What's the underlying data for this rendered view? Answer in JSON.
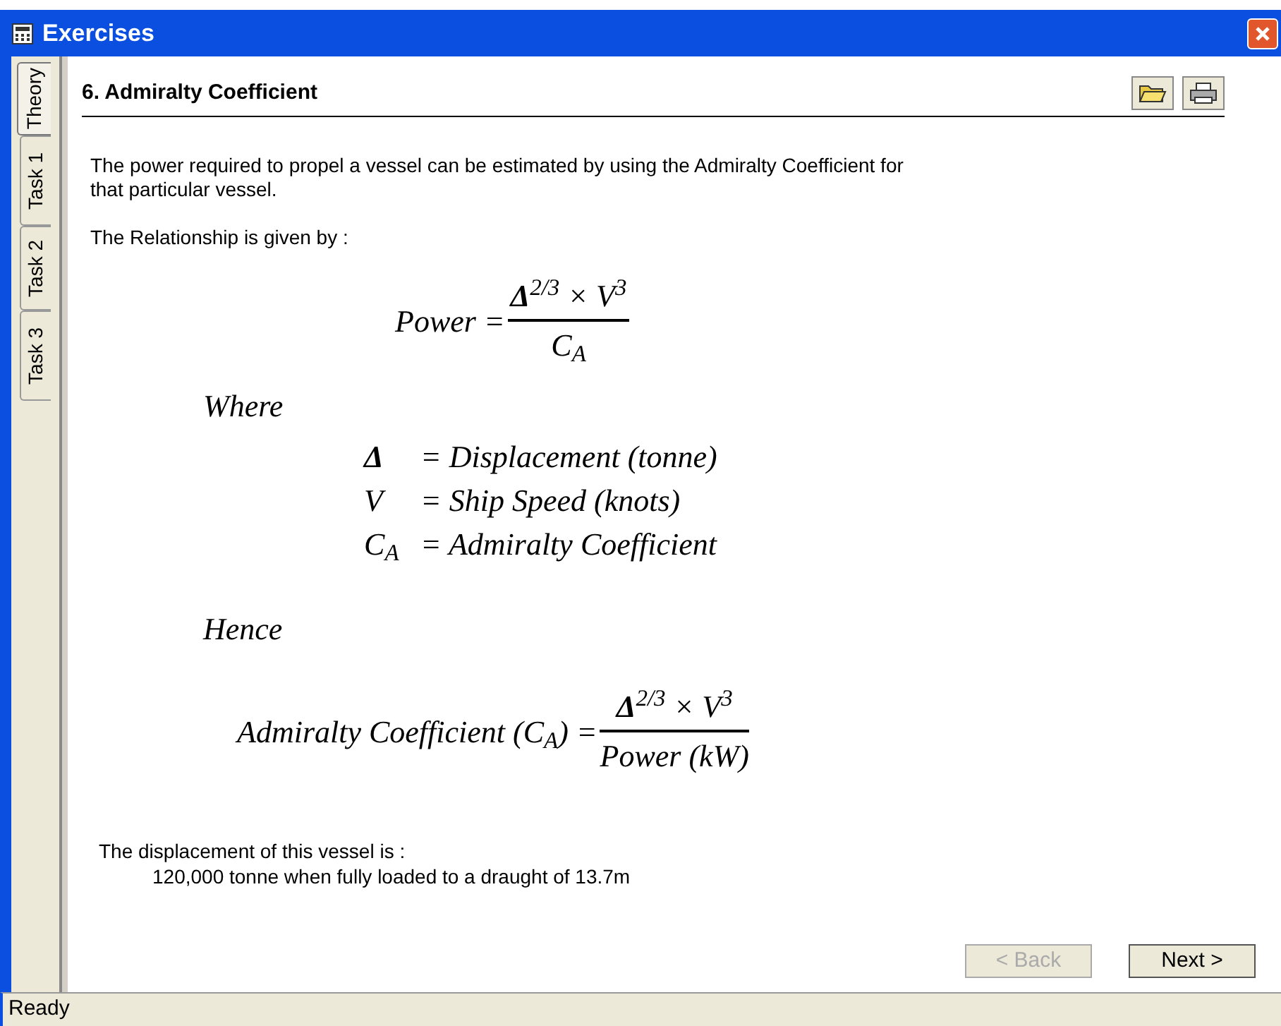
{
  "window": {
    "title": "Exercises"
  },
  "tabs": [
    {
      "label": "Theory",
      "selected": true
    },
    {
      "label": "Task 1",
      "selected": false
    },
    {
      "label": "Task 2",
      "selected": false
    },
    {
      "label": "Task 3",
      "selected": false
    }
  ],
  "heading": "6. Admiralty Coefficient",
  "intro": "The power required to propel a vessel can be estimated by using the Admiralty Coefficient for that particular vessel.",
  "relationship": "The Relationship is given by :",
  "formula_1": {
    "lhs": "Power =",
    "numerator": "**Δ**$^{2/3}$ × V$^{3}$",
    "denominator": "C$_{A}$"
  },
  "where": "Where",
  "definitions": [
    {
      "symbol": "**Δ**",
      "definition": "= Displacement (tonne)"
    },
    {
      "symbol": "V",
      "definition": "= Ship Speed (knots)"
    },
    {
      "symbol": "C$_{A}$",
      "definition": "= Admiralty Coefficient"
    }
  ],
  "hence": "Hence",
  "formula_2": {
    "lhs": "Admiralty Coefficient (C$_{A}$) =",
    "numerator": "**Δ**$^{2/3}$ × V$^{3}$",
    "denominator": "Power (kW)"
  },
  "displacement_label": "The displacement of this vessel is :",
  "displacement_value": "120,000 tonne when fully loaded to a draught of 13.7m",
  "buttons": [
    {
      "label": "< Back",
      "disabled": true
    },
    {
      "label": "Next >",
      "disabled": false
    }
  ],
  "status_bar": "Ready"
}
